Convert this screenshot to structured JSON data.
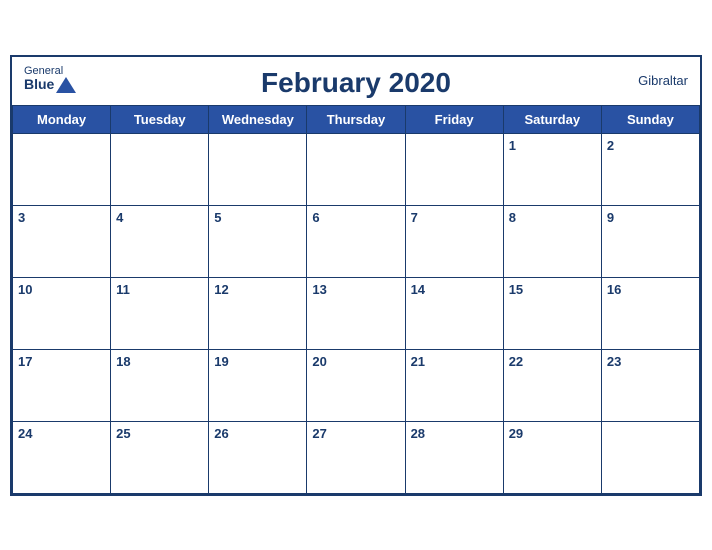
{
  "header": {
    "title": "February 2020",
    "location": "Gibraltar",
    "logo_general": "General",
    "logo_blue": "Blue"
  },
  "weekdays": [
    "Monday",
    "Tuesday",
    "Wednesday",
    "Thursday",
    "Friday",
    "Saturday",
    "Sunday"
  ],
  "weeks": [
    [
      null,
      null,
      null,
      null,
      null,
      1,
      2
    ],
    [
      3,
      4,
      5,
      6,
      7,
      8,
      9
    ],
    [
      10,
      11,
      12,
      13,
      14,
      15,
      16
    ],
    [
      17,
      18,
      19,
      20,
      21,
      22,
      23
    ],
    [
      24,
      25,
      26,
      27,
      28,
      29,
      null
    ]
  ]
}
